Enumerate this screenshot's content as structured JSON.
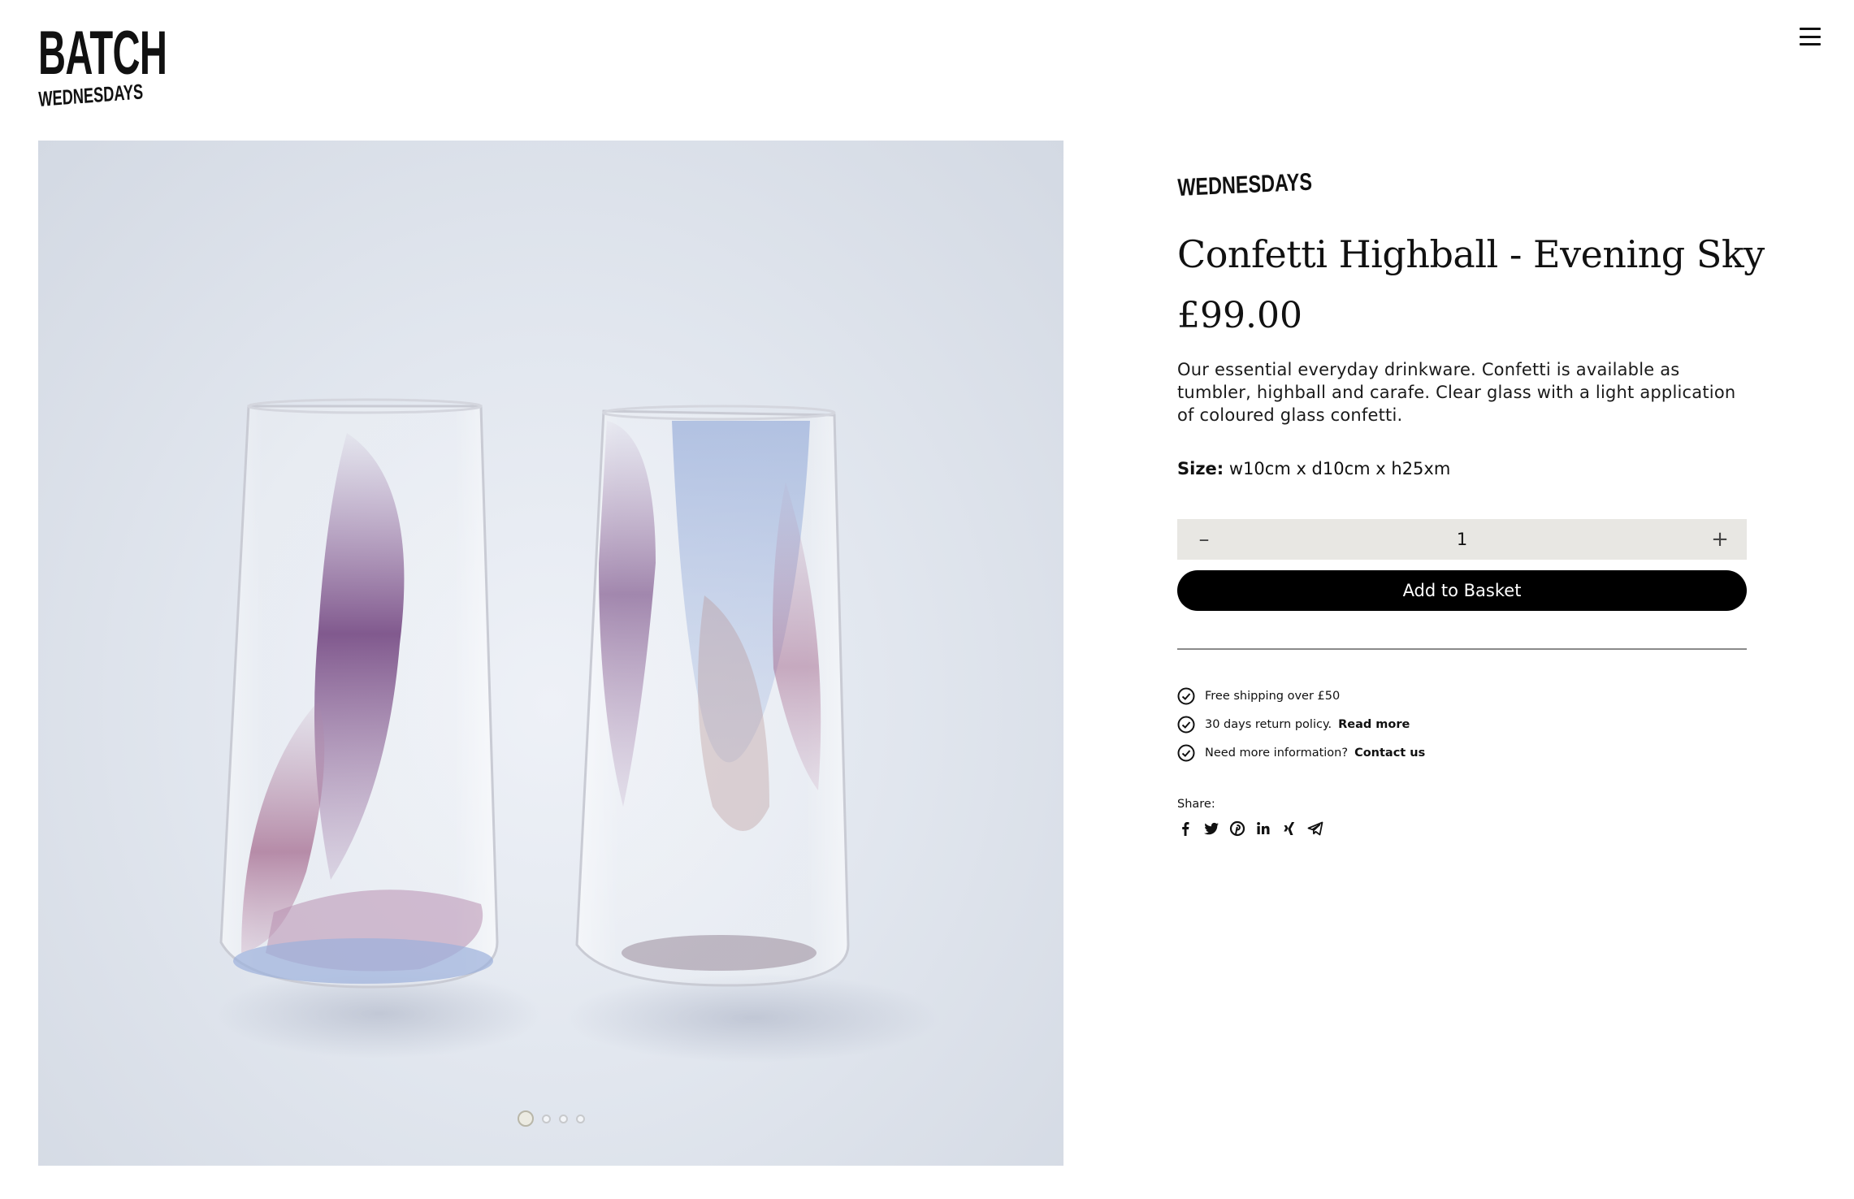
{
  "header": {
    "logo_main": "BATCH",
    "logo_sub": "WEDNESDAYS",
    "menu_icon": "hamburger-menu-icon"
  },
  "gallery": {
    "image_alt": "Two tall glass highballs with purple and blue confetti swirls",
    "slide_count": 4,
    "active_slide": 1
  },
  "product": {
    "brand": "WEDNESDAYS",
    "title": "Confetti Highball - Evening Sky",
    "price": "£99.00",
    "description": "Our essential everyday drinkware. Confetti is available as tumbler, highball and carafe. Clear glass with a light application of coloured glass confetti.",
    "size_label": "Size:",
    "size_value": "w10cm x d10cm x h25xm",
    "quantity": "1",
    "minus_label": "–",
    "plus_label": "+",
    "add_to_basket": "Add to Basket"
  },
  "perks": [
    {
      "text": "Free shipping over £50",
      "link": ""
    },
    {
      "text": "30 days return policy.",
      "link": "Read more"
    },
    {
      "text": "Need more information?",
      "link": "Contact us"
    }
  ],
  "share": {
    "label": "Share:",
    "icons": [
      "facebook-icon",
      "twitter-icon",
      "pinterest-icon",
      "linkedin-icon",
      "xing-icon",
      "telegram-icon"
    ]
  },
  "colors": {
    "button_bg": "#000000",
    "quantity_bg": "#e8e7e3",
    "text": "#111111"
  }
}
